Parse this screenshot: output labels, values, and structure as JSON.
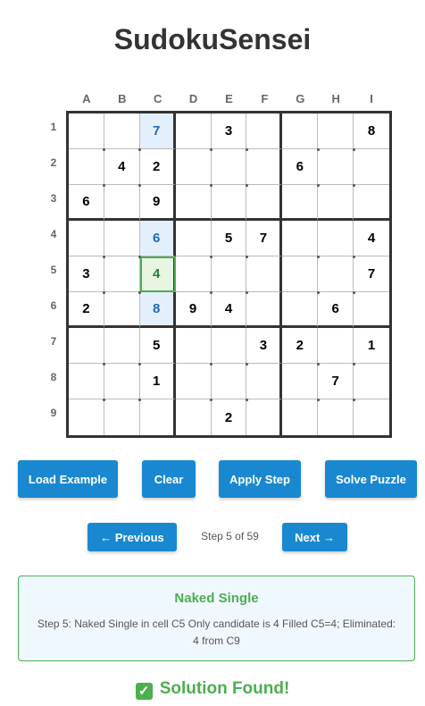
{
  "app": {
    "title": "SudokuSensei"
  },
  "grid": {
    "columns": [
      "A",
      "B",
      "C",
      "D",
      "E",
      "F",
      "G",
      "H",
      "I"
    ],
    "rows": [
      "1",
      "2",
      "3",
      "4",
      "5",
      "6",
      "7",
      "8",
      "9"
    ],
    "cells": [
      [
        "",
        "",
        "7",
        "",
        "3",
        "",
        "",
        "",
        "8"
      ],
      [
        "",
        "4",
        "2",
        "",
        "",
        "",
        "6",
        "",
        ""
      ],
      [
        "6",
        "",
        "9",
        "",
        "",
        "",
        "",
        "",
        ""
      ],
      [
        "",
        "",
        "6",
        "",
        "5",
        "7",
        "",
        "",
        "4"
      ],
      [
        "3",
        "",
        "4",
        "",
        "",
        "",
        "",
        "",
        "7"
      ],
      [
        "2",
        "",
        "8",
        "9",
        "4",
        "",
        "",
        "6",
        ""
      ],
      [
        "",
        "",
        "5",
        "",
        "",
        "3",
        "2",
        "",
        "1"
      ],
      [
        "",
        "",
        "1",
        "",
        "",
        "",
        "",
        "7",
        ""
      ],
      [
        "",
        "",
        "",
        "",
        "2",
        "",
        "",
        "",
        ""
      ]
    ],
    "highlighted": [
      "C1",
      "C4",
      "C6"
    ],
    "current_cell": "C5",
    "colors": {
      "highlight_bg": "#e3f0fb",
      "highlight_text": "#1e6bb8",
      "current_border": "#4caf50"
    }
  },
  "buttons": {
    "load_example": "Load Example",
    "clear": "Clear",
    "apply_step": "Apply Step",
    "solve_puzzle": "Solve Puzzle",
    "previous": "← Previous",
    "next": "Next →"
  },
  "step": {
    "label": "Step 5 of 59",
    "current": 5,
    "total": 59
  },
  "info": {
    "title": "Naked Single",
    "text": "Step 5: Naked Single in cell C5 Only candidate is 4 Filled C5=4; Eliminated: 4 from C9"
  },
  "status": {
    "text": "Solution Found!",
    "icon": "checkmark-icon"
  },
  "colors": {
    "accent": "#1a88d1",
    "success": "#4caf50"
  }
}
